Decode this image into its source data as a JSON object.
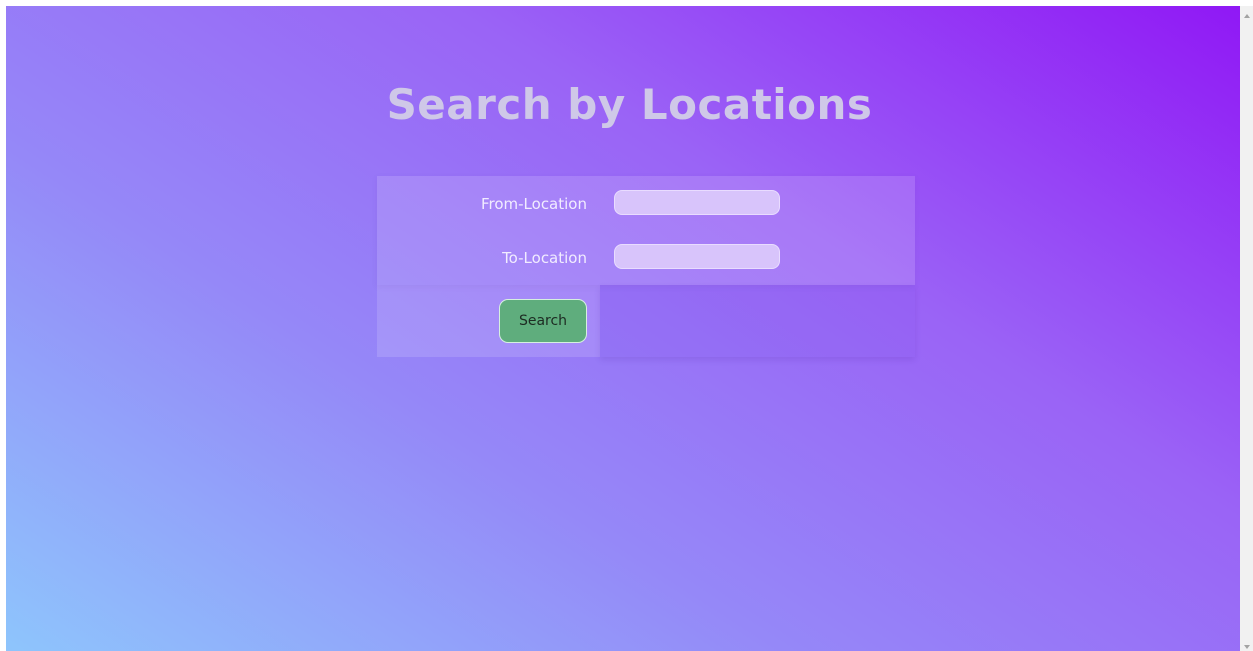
{
  "page": {
    "title": "Search by Locations"
  },
  "form": {
    "from_label": "From-Location",
    "from_value": "",
    "to_label": "To-Location",
    "to_value": "",
    "search_label": "Search"
  },
  "colors": {
    "gradient_start": "#8ec5fc",
    "gradient_end": "#9018f5",
    "title_color": "#cfc8e8",
    "button_color": "#5fad7d",
    "input_color": "#d8c4fb"
  },
  "icons": {
    "scroll_up": "scroll-up-arrow-icon",
    "scroll_down": "scroll-down-arrow-icon"
  }
}
